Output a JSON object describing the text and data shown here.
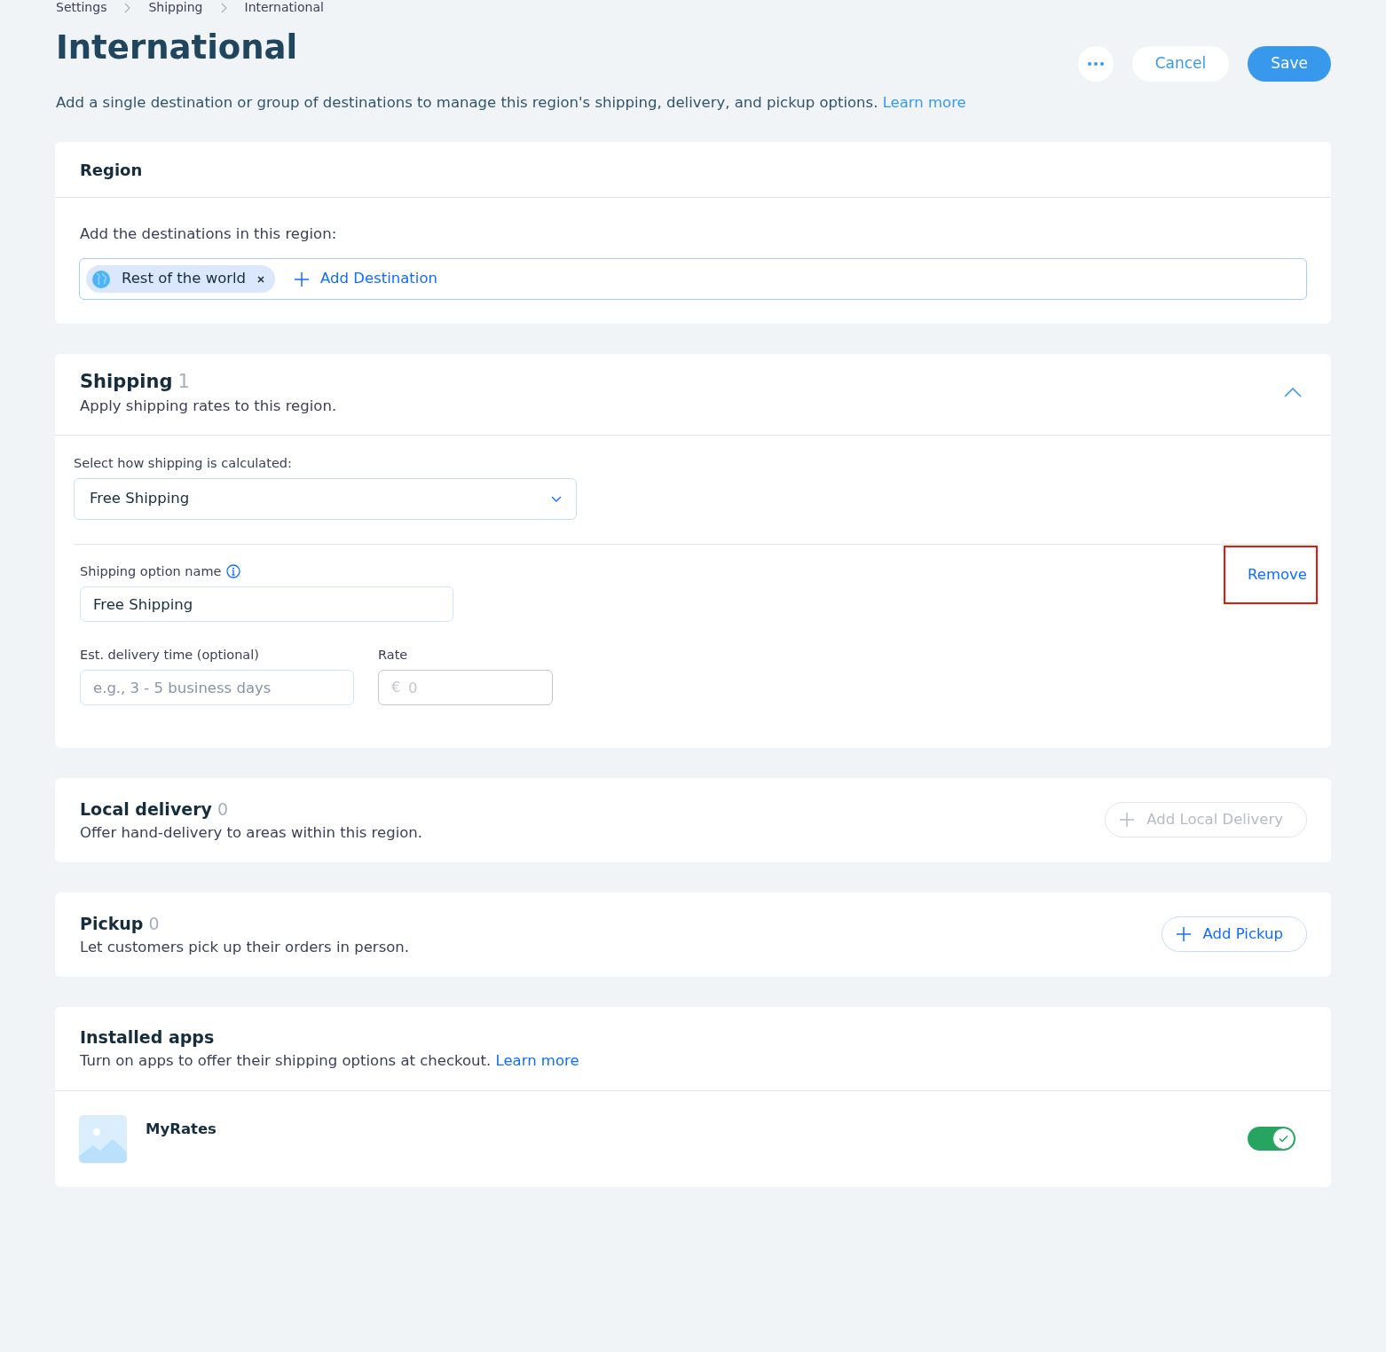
{
  "breadcrumbs": [
    {
      "label": "Settings"
    },
    {
      "label": "Shipping"
    },
    {
      "label": "International"
    }
  ],
  "header": {
    "title": "International",
    "description": "Add a single destination or group of destinations to manage this region's shipping, delivery, and pickup options.",
    "description_link": "Learn more",
    "actions": [
      {
        "kind": "more"
      },
      {
        "kind": "secondary",
        "label": "Cancel"
      },
      {
        "kind": "primary",
        "label": "Save"
      }
    ]
  },
  "region": {
    "title": "Region",
    "label": "Add the destinations in this region:",
    "destinations": [
      {
        "label": "Rest of the world"
      }
    ],
    "add_button": "Add Destination"
  },
  "shipping": {
    "title": "Shipping",
    "count": "1",
    "subtitle": "Apply shipping rates to this region.",
    "expanded": true,
    "method_label": "Select how shipping is calculated:",
    "method_value": "Free Shipping",
    "option": {
      "name_label": "Shipping option name",
      "name_value": "Free Shipping",
      "remove": {
        "label": "Remove",
        "highlighted": true
      },
      "delivery_label": "Est. delivery time (optional)",
      "delivery_placeholder": "e.g., 3 - 5 business days",
      "rate_label": "Rate",
      "rate_prefix": "€",
      "rate_placeholder": "0",
      "rate_disabled": true
    }
  },
  "sections": [
    {
      "title": "Local delivery",
      "count": "0",
      "subtitle": "Offer hand-delivery to areas within this region.",
      "button": {
        "label": "Add Local Delivery",
        "disabled": true
      }
    },
    {
      "title": "Pickup",
      "count": "0",
      "subtitle": "Let customers pick up their orders in person.",
      "button": {
        "label": "Add Pickup",
        "disabled": false
      }
    }
  ],
  "installed_apps": {
    "title": "Installed apps",
    "subtitle": "Turn on apps to offer their shipping options at checkout.",
    "link": "Learn more",
    "apps": [
      {
        "name": "MyRates",
        "on": true
      }
    ]
  }
}
